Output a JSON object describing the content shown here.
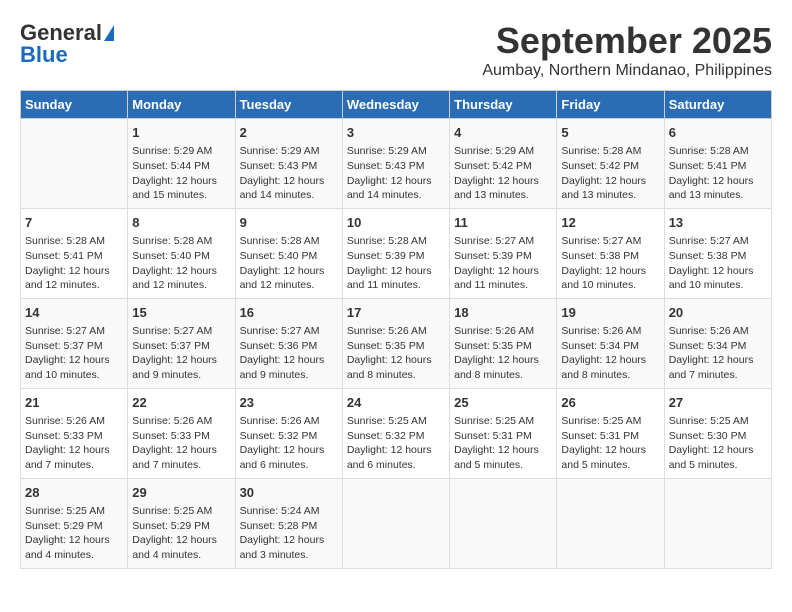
{
  "header": {
    "logo_general": "General",
    "logo_blue": "Blue",
    "month": "September 2025",
    "location": "Aumbay, Northern Mindanao, Philippines"
  },
  "days_of_week": [
    "Sunday",
    "Monday",
    "Tuesday",
    "Wednesday",
    "Thursday",
    "Friday",
    "Saturday"
  ],
  "weeks": [
    [
      {
        "day": "",
        "info": ""
      },
      {
        "day": "1",
        "info": "Sunrise: 5:29 AM\nSunset: 5:44 PM\nDaylight: 12 hours\nand 15 minutes."
      },
      {
        "day": "2",
        "info": "Sunrise: 5:29 AM\nSunset: 5:43 PM\nDaylight: 12 hours\nand 14 minutes."
      },
      {
        "day": "3",
        "info": "Sunrise: 5:29 AM\nSunset: 5:43 PM\nDaylight: 12 hours\nand 14 minutes."
      },
      {
        "day": "4",
        "info": "Sunrise: 5:29 AM\nSunset: 5:42 PM\nDaylight: 12 hours\nand 13 minutes."
      },
      {
        "day": "5",
        "info": "Sunrise: 5:28 AM\nSunset: 5:42 PM\nDaylight: 12 hours\nand 13 minutes."
      },
      {
        "day": "6",
        "info": "Sunrise: 5:28 AM\nSunset: 5:41 PM\nDaylight: 12 hours\nand 13 minutes."
      }
    ],
    [
      {
        "day": "7",
        "info": "Sunrise: 5:28 AM\nSunset: 5:41 PM\nDaylight: 12 hours\nand 12 minutes."
      },
      {
        "day": "8",
        "info": "Sunrise: 5:28 AM\nSunset: 5:40 PM\nDaylight: 12 hours\nand 12 minutes."
      },
      {
        "day": "9",
        "info": "Sunrise: 5:28 AM\nSunset: 5:40 PM\nDaylight: 12 hours\nand 12 minutes."
      },
      {
        "day": "10",
        "info": "Sunrise: 5:28 AM\nSunset: 5:39 PM\nDaylight: 12 hours\nand 11 minutes."
      },
      {
        "day": "11",
        "info": "Sunrise: 5:27 AM\nSunset: 5:39 PM\nDaylight: 12 hours\nand 11 minutes."
      },
      {
        "day": "12",
        "info": "Sunrise: 5:27 AM\nSunset: 5:38 PM\nDaylight: 12 hours\nand 10 minutes."
      },
      {
        "day": "13",
        "info": "Sunrise: 5:27 AM\nSunset: 5:38 PM\nDaylight: 12 hours\nand 10 minutes."
      }
    ],
    [
      {
        "day": "14",
        "info": "Sunrise: 5:27 AM\nSunset: 5:37 PM\nDaylight: 12 hours\nand 10 minutes."
      },
      {
        "day": "15",
        "info": "Sunrise: 5:27 AM\nSunset: 5:37 PM\nDaylight: 12 hours\nand 9 minutes."
      },
      {
        "day": "16",
        "info": "Sunrise: 5:27 AM\nSunset: 5:36 PM\nDaylight: 12 hours\nand 9 minutes."
      },
      {
        "day": "17",
        "info": "Sunrise: 5:26 AM\nSunset: 5:35 PM\nDaylight: 12 hours\nand 8 minutes."
      },
      {
        "day": "18",
        "info": "Sunrise: 5:26 AM\nSunset: 5:35 PM\nDaylight: 12 hours\nand 8 minutes."
      },
      {
        "day": "19",
        "info": "Sunrise: 5:26 AM\nSunset: 5:34 PM\nDaylight: 12 hours\nand 8 minutes."
      },
      {
        "day": "20",
        "info": "Sunrise: 5:26 AM\nSunset: 5:34 PM\nDaylight: 12 hours\nand 7 minutes."
      }
    ],
    [
      {
        "day": "21",
        "info": "Sunrise: 5:26 AM\nSunset: 5:33 PM\nDaylight: 12 hours\nand 7 minutes."
      },
      {
        "day": "22",
        "info": "Sunrise: 5:26 AM\nSunset: 5:33 PM\nDaylight: 12 hours\nand 7 minutes."
      },
      {
        "day": "23",
        "info": "Sunrise: 5:26 AM\nSunset: 5:32 PM\nDaylight: 12 hours\nand 6 minutes."
      },
      {
        "day": "24",
        "info": "Sunrise: 5:25 AM\nSunset: 5:32 PM\nDaylight: 12 hours\nand 6 minutes."
      },
      {
        "day": "25",
        "info": "Sunrise: 5:25 AM\nSunset: 5:31 PM\nDaylight: 12 hours\nand 5 minutes."
      },
      {
        "day": "26",
        "info": "Sunrise: 5:25 AM\nSunset: 5:31 PM\nDaylight: 12 hours\nand 5 minutes."
      },
      {
        "day": "27",
        "info": "Sunrise: 5:25 AM\nSunset: 5:30 PM\nDaylight: 12 hours\nand 5 minutes."
      }
    ],
    [
      {
        "day": "28",
        "info": "Sunrise: 5:25 AM\nSunset: 5:29 PM\nDaylight: 12 hours\nand 4 minutes."
      },
      {
        "day": "29",
        "info": "Sunrise: 5:25 AM\nSunset: 5:29 PM\nDaylight: 12 hours\nand 4 minutes."
      },
      {
        "day": "30",
        "info": "Sunrise: 5:24 AM\nSunset: 5:28 PM\nDaylight: 12 hours\nand 3 minutes."
      },
      {
        "day": "",
        "info": ""
      },
      {
        "day": "",
        "info": ""
      },
      {
        "day": "",
        "info": ""
      },
      {
        "day": "",
        "info": ""
      }
    ]
  ]
}
